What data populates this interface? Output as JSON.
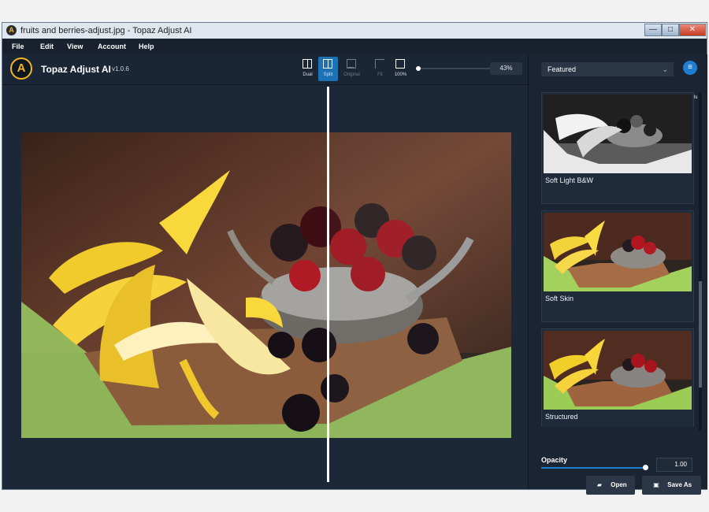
{
  "window": {
    "title": "fruits and berries-adjust.jpg - Topaz Adjust AI",
    "controls": {
      "minimize": "—",
      "maximize": "□",
      "close": "✕"
    }
  },
  "menu": [
    {
      "label": "File"
    },
    {
      "label": "Edit"
    },
    {
      "label": "View"
    },
    {
      "label": "Account"
    },
    {
      "label": "Help"
    }
  ],
  "app": {
    "logo_letter": "A",
    "name": "Topaz Adjust AI",
    "version": "v1.0.6"
  },
  "toolbar": {
    "tools": [
      {
        "label": "Dual",
        "icon": "dual-view-icon",
        "active": false,
        "disabled": false
      },
      {
        "label": "Split",
        "icon": "split-view-icon",
        "active": true,
        "disabled": false
      },
      {
        "label": "Original",
        "icon": "original-image-icon",
        "active": false,
        "disabled": true
      },
      {
        "label": "Fit",
        "icon": "fit-screen-icon",
        "active": false,
        "disabled": true
      },
      {
        "label": "100%",
        "icon": "actual-size-icon",
        "active": false,
        "disabled": false
      }
    ],
    "zoom_value": "43%"
  },
  "sidebar": {
    "dropdown_value": "Featured",
    "controls_label": "Controls",
    "presets": [
      {
        "label": "Soft Light B&W",
        "style": "bw"
      },
      {
        "label": "Soft Skin",
        "style": "color"
      },
      {
        "label": "Structured",
        "style": "color"
      }
    ],
    "opacity": {
      "label": "Opacity",
      "value": "1.00"
    }
  },
  "buttons": {
    "open_label": "Open",
    "save_as_label": "Save As"
  },
  "colors": {
    "accent": "#1f7ed1",
    "brand": "#f3b521",
    "panel": "#1c2838"
  }
}
